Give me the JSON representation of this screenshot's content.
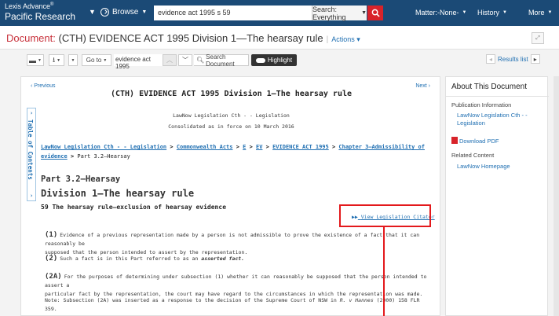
{
  "brand": {
    "line1": "Lexis Advance",
    "reg": "®",
    "line2": "Pacific Research"
  },
  "nav": {
    "browse_label": "Browse",
    "search_value": "evidence act 1995 s 59",
    "search_scope": "Search: Everything",
    "matter_label": "Matter:-None-",
    "history_label": "History",
    "more_label": "More"
  },
  "doc_title": {
    "prefix": "Document:",
    "title": "(CTH) EVIDENCE ACT 1995 Division 1—The hearsay rule",
    "actions_label": "Actions"
  },
  "toolbar": {
    "goto_label": "Go to",
    "search_term": "evidence act 1995",
    "search_document_label": "Search Document",
    "highlight_label": "Highlight",
    "results_list_label": "Results list"
  },
  "doc": {
    "previous_label": "Previous",
    "next_label": "Next",
    "heading": "(CTH) EVIDENCE ACT 1995 Division 1—The hearsay rule",
    "legislation_line": "LawNow Legislation Cth - - Legislation",
    "consolidated_line": "Consolidated as in force on 10 March 2016",
    "breadcrumb": {
      "items": [
        "LawNow Legislation Cth - - Legislation",
        "Commonwealth Acts",
        "E",
        "EV",
        "EVIDENCE ACT 1995",
        "Chapter 3—Admissibility of evidence"
      ],
      "separator": ">",
      "current": "Part 3.2—Hearsay"
    },
    "part_heading": "Part 3.2—Hearsay",
    "division_heading": "Division 1—The hearsay rule",
    "section_heading": "59 The hearsay rule—exclusion of hearsay evidence",
    "citator_label": "View Legislation Citator",
    "citator_icon": "double-chevron-right",
    "para1_num": "(1)",
    "para1_line1": "Evidence of a previous representation made by a person is not admissible to prove the existence of a fact that it can reasonably be",
    "para1_line2": "supposed that the person intended to assert by the representation.",
    "para2_num": "(2)",
    "para2_text": "Such a fact is in this Part referred to as an",
    "para2_term": "asserted fact.",
    "para2a_num": "(2A)",
    "para2a_line1": "For the purposes of determining under subsection (1) whether it can reasonably be supposed that the person intended to assert a",
    "para2a_line2": "particular fact by the representation, the court may have regard to the circumstances in which the representation was made.",
    "note_text": "Note: Subsection (2A) was inserted as a response to the decision of the Supreme Court of NSW in",
    "note_case": "R. v Hannes",
    "note_cite": "(2000) 158 FLR 359.",
    "toc_label": "Table of Contents"
  },
  "about": {
    "title": "About This Document",
    "pub_info_label": "Publication Information",
    "pub_link_line1": "LawNow Legislation Cth - -",
    "pub_link_line2": "Legislation",
    "download_pdf_label": "Download PDF",
    "related_label": "Related Content",
    "homepage_label": "LawNow Homepage"
  },
  "colors": {
    "topbar": "#1b4a76",
    "accent_red": "#d8232a",
    "callout_red": "#e3191c",
    "link_blue": "#1f6fb2"
  }
}
